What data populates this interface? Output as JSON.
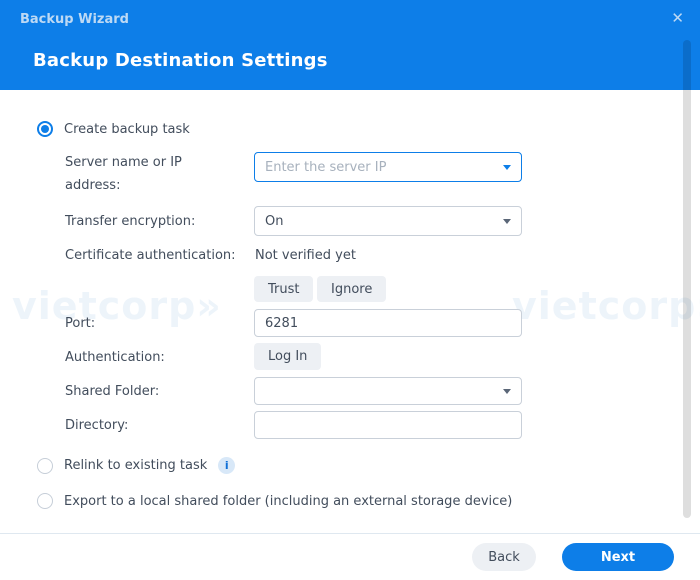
{
  "window": {
    "title": "Backup Wizard",
    "close_glyph": "✕"
  },
  "header": {
    "title": "Backup Destination Settings"
  },
  "options": {
    "create": {
      "label": "Create backup task",
      "selected": true
    },
    "relink": {
      "label": "Relink to existing task",
      "info_glyph": "i"
    },
    "export": {
      "label": "Export to a local shared folder (including an external storage device)"
    }
  },
  "form": {
    "server": {
      "label_line1": "Server name or IP",
      "label_line2": "address:",
      "placeholder": "Enter the server IP",
      "value": ""
    },
    "encryption": {
      "label": "Transfer encryption:",
      "value": "On"
    },
    "certificate": {
      "label": "Certificate authentication:",
      "status": "Not verified yet",
      "trust_label": "Trust",
      "ignore_label": "Ignore"
    },
    "port": {
      "label": "Port:",
      "value": "6281"
    },
    "auth": {
      "label": "Authentication:",
      "login_label": "Log In"
    },
    "shared_folder": {
      "label": "Shared Folder:",
      "value": ""
    },
    "directory": {
      "label": "Directory:",
      "value": ""
    }
  },
  "footer": {
    "back_label": "Back",
    "next_label": "Next"
  },
  "watermark": {
    "text": "vietcorp»"
  },
  "colors": {
    "primary": "#0d7ee8",
    "titlebar_text": "#bdd9f4",
    "label_text": "#424d5c"
  }
}
